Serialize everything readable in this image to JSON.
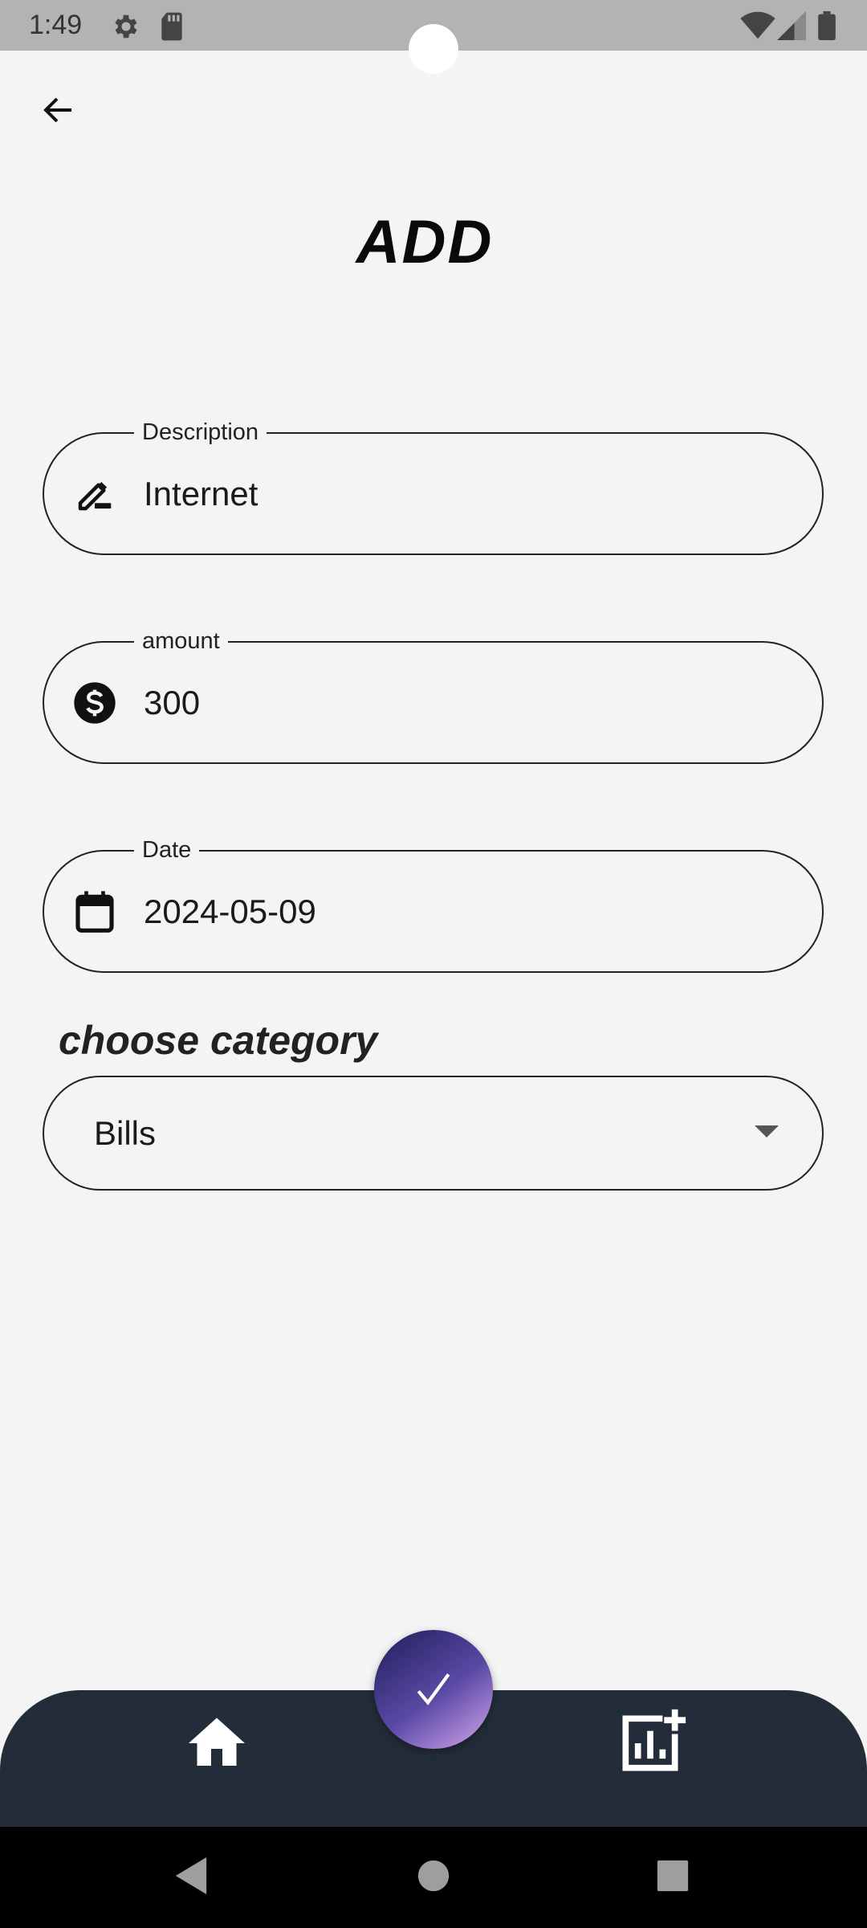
{
  "status_bar": {
    "time": "1:49",
    "icons": [
      "settings-icon",
      "sd-card-icon",
      "wifi-icon",
      "signal-icon",
      "battery-icon"
    ]
  },
  "header": {
    "back_icon": "arrow-back-icon",
    "title": "ADD"
  },
  "form": {
    "description": {
      "label": "Description",
      "value": "Internet",
      "icon": "edit-icon"
    },
    "amount": {
      "label": "amount",
      "value": "300",
      "icon": "dollar-icon"
    },
    "date": {
      "label": "Date",
      "value": "2024-05-09",
      "icon": "calendar-icon"
    },
    "category": {
      "heading": "choose category",
      "selected": "Bills"
    }
  },
  "bottom_nav": {
    "items": [
      {
        "icon": "home-icon"
      },
      {
        "icon": "add-chart-icon"
      }
    ],
    "fab_icon": "check-icon"
  },
  "system_nav": [
    "back-triangle-icon",
    "home-circle-icon",
    "recents-square-icon"
  ],
  "colors": {
    "background": "#f4f4f4",
    "bottom_bar": "#232d3a",
    "fab_gradient_start": "#2a2668",
    "fab_gradient_end": "#d7a8ef"
  }
}
